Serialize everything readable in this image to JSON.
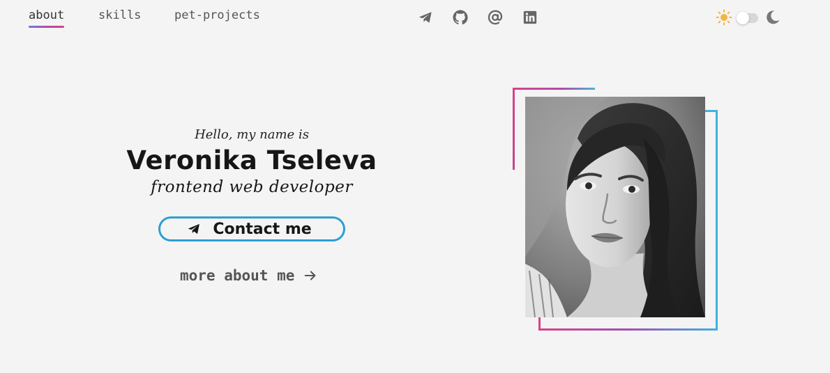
{
  "nav": {
    "tabs": [
      {
        "label": "about",
        "active": true
      },
      {
        "label": "skills",
        "active": false
      },
      {
        "label": "pet-projects",
        "active": false
      }
    ]
  },
  "social": [
    {
      "icon": "telegram-icon"
    },
    {
      "icon": "github-icon"
    },
    {
      "icon": "email-icon"
    },
    {
      "icon": "linkedin-icon"
    }
  ],
  "theme": {
    "light_icon": "sun-icon",
    "dark_icon": "moon-icon",
    "dark_mode": false
  },
  "hero": {
    "greeting": "Hello, my name is",
    "name": "Veronika Tseleva",
    "role": "frontend web developer",
    "contact_label": "Contact me",
    "contact_icon": "telegram-icon",
    "more_label": "more about me",
    "more_icon": "arrow-right-icon"
  },
  "colors": {
    "background": "#f4f4f4",
    "accent_blue": "#2c9fd0",
    "accent_pink": "#d8418a",
    "accent_purple": "#b24aa8",
    "sun": "#f2b640",
    "icon_gray": "#666666"
  }
}
